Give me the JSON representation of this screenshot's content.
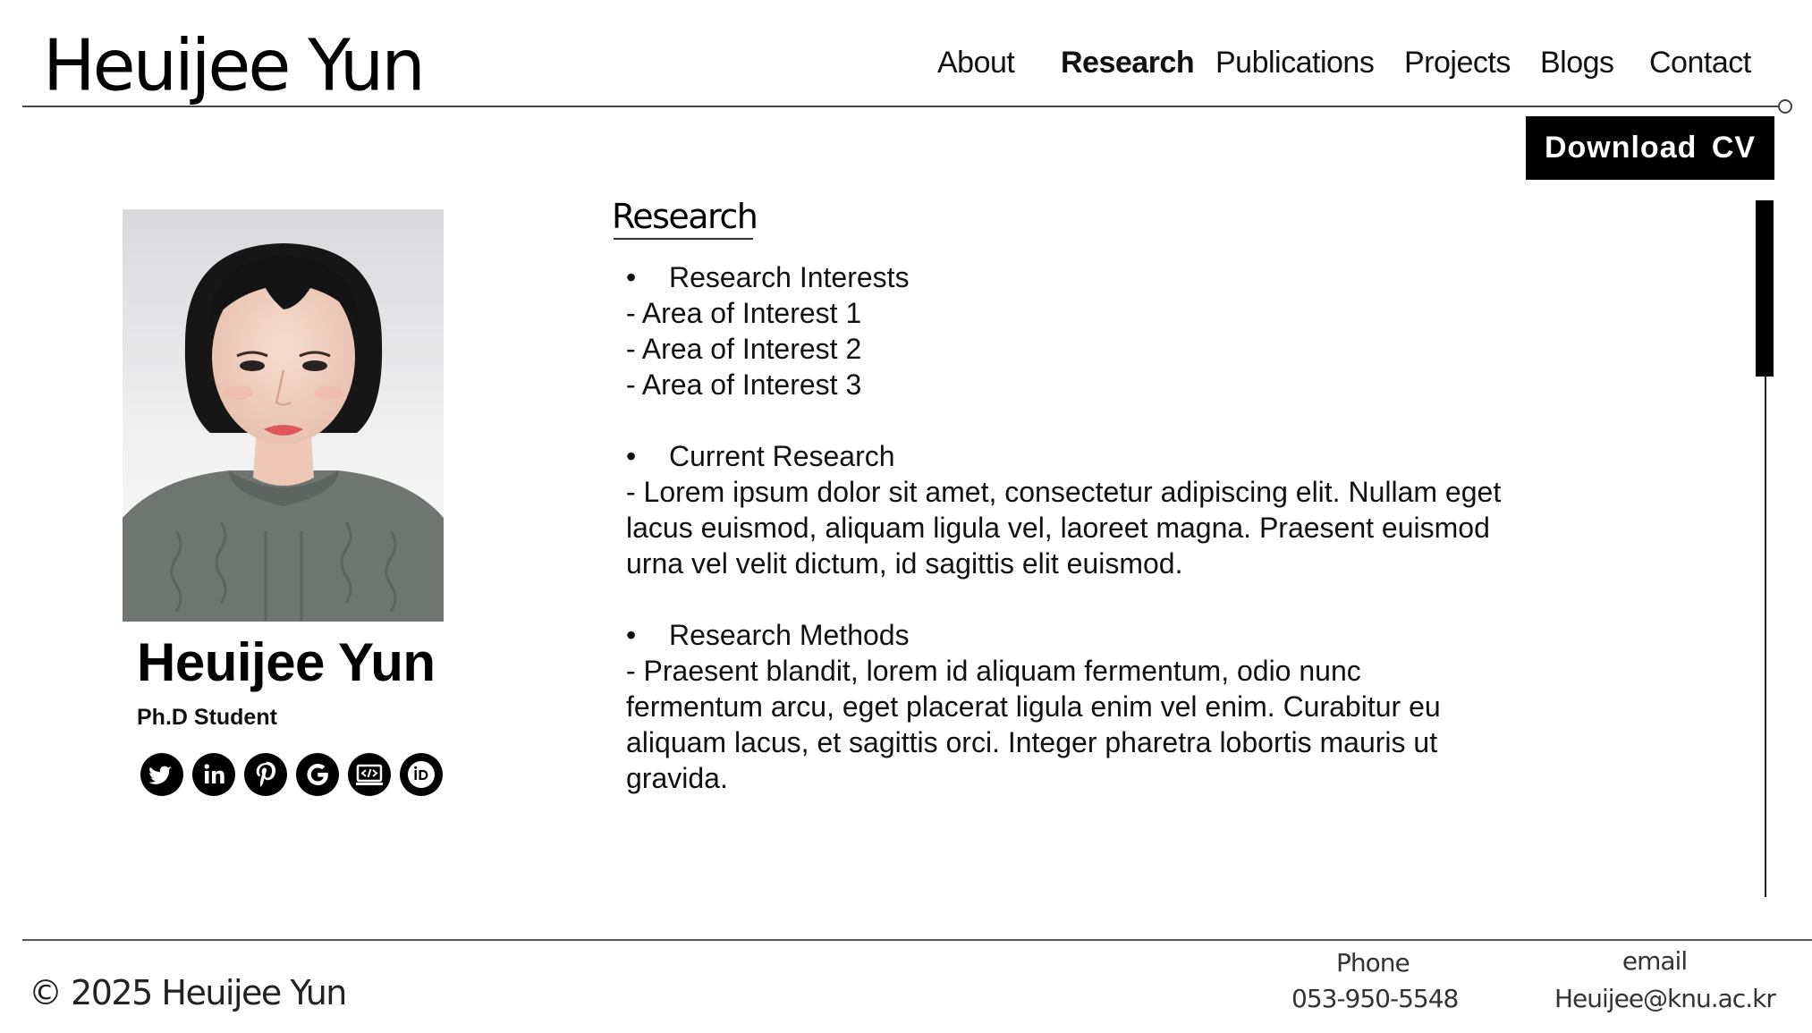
{
  "site": {
    "title": "Heuijee Yun"
  },
  "nav": {
    "items": [
      {
        "label": "About"
      },
      {
        "label": "Research",
        "active": true
      },
      {
        "label": "Publications"
      },
      {
        "label": "Projects"
      },
      {
        "label": "Blogs"
      },
      {
        "label": "Contact"
      }
    ]
  },
  "actions": {
    "download_cv": "Download CV"
  },
  "profile": {
    "name": "Heuijee Yun",
    "role": "Ph.D Student",
    "socials": [
      {
        "icon": "twitter-icon"
      },
      {
        "icon": "linkedin-icon"
      },
      {
        "icon": "pinterest-icon"
      },
      {
        "icon": "google-icon"
      },
      {
        "icon": "code-screen-icon"
      },
      {
        "icon": "orcid-icon"
      }
    ]
  },
  "research": {
    "heading": "Research",
    "sections": [
      {
        "title": "Research Interests",
        "lines": [
          "- Area of Interest 1",
          "- Area of Interest 2",
          "- Area of Interest 3"
        ]
      },
      {
        "title": "Current Research",
        "lines": [
          "- Lorem ipsum dolor sit amet, consectetur adipiscing elit. Nullam eget",
          "lacus euismod, aliquam ligula vel, laoreet magna. Praesent euismod",
          "urna vel velit dictum, id sagittis elit euismod."
        ]
      },
      {
        "title": "Research Methods",
        "lines": [
          "- Praesent blandit, lorem id aliquam fermentum, odio nunc",
          "fermentum arcu, eget placerat ligula enim vel enim. Curabitur eu",
          "aliquam lacus, et sagittis orci. Integer pharetra lobortis mauris ut",
          "gravida."
        ]
      }
    ],
    "bullet": "•"
  },
  "footer": {
    "copyright": "© 2025 Heuijee Yun",
    "phone_label": "Phone",
    "phone": "053-950-5548",
    "email_label": "email",
    "email": "Heuijee@knu.ac.kr"
  },
  "colors": {
    "accent": "#000000",
    "background": "#ffffff",
    "sweater": "#6f7570"
  }
}
